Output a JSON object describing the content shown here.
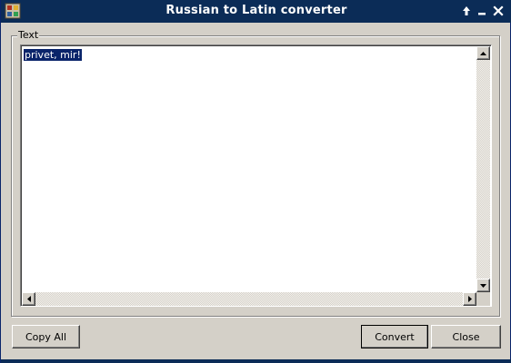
{
  "window": {
    "title": "Russian to Latin converter",
    "app_icon": "app-icon",
    "controls": [
      "maximize-icon",
      "minimize-icon",
      "close-icon"
    ],
    "titlebar_color": "#0b2c57"
  },
  "group": {
    "label": "Text"
  },
  "textarea": {
    "value": "privet, mir!",
    "selected": true,
    "selection_color": "#0a246a"
  },
  "buttons": {
    "copy_all": "Copy All",
    "convert": "Convert",
    "close": "Close"
  }
}
